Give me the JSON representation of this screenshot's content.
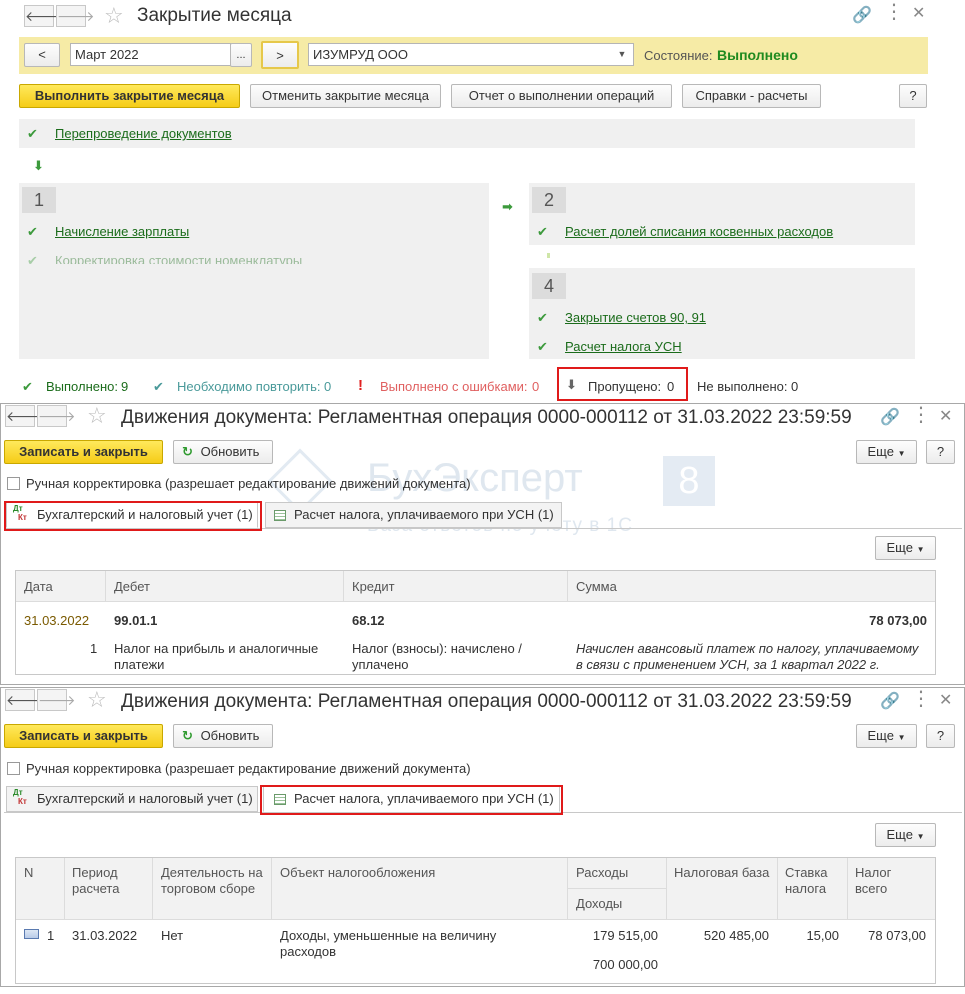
{
  "window1": {
    "title": "Закрытие месяца",
    "period": "Март 2022",
    "period_dots": "...",
    "prev": "<",
    "next": ">",
    "org": "ИЗУМРУД ООО",
    "state_label": "Состояние:",
    "state_value": "Выполнено",
    "buttons": {
      "run": "Выполнить закрытие месяца",
      "cancel": "Отменить закрытие месяца",
      "report": "Отчет о выполнении операций",
      "refs": "Справки - расчеты",
      "help": "?"
    },
    "reposting": "Перепроведение документов",
    "step1": {
      "num": "1",
      "item1": "Начисление зарплаты",
      "item2": "Корректировка стоимости номенклатуры"
    },
    "step2": {
      "num": "2",
      "item1": "Расчет долей списания косвенных расходов"
    },
    "step4": {
      "num": "4",
      "item1": "Закрытие счетов 90, 91",
      "item2": "Расчет налога УСН"
    },
    "status": {
      "done_label": "Выполнено:",
      "done_count": "9",
      "repeat_label": "Необходимо повторить:",
      "repeat_count": "0",
      "errors_label": "Выполнено с ошибками:",
      "errors_count": "0",
      "skipped_label": "Пропущено:",
      "skipped_count": "0",
      "notdone_label": "Не выполнено:",
      "notdone_count": "0"
    }
  },
  "movement_window": {
    "title": "Движения документа: Регламентная операция 0000-000112 от 31.03.2022 23:59:59",
    "save_close": "Записать и закрыть",
    "refresh": "Обновить",
    "more": "Еще",
    "help": "?",
    "manual_correction": "Ручная корректировка (разрешает редактирование движений документа)",
    "tab_accounting": "Бухгалтерский и налоговый учет (1)",
    "tab_usn": "Расчет налога, уплачиваемого при УСН (1)",
    "tab_icon_dt": "Дт",
    "tab_icon_kt": "Кт"
  },
  "watermark": {
    "brand": "БухЭксперт",
    "digit": "8",
    "tagline": "База ответов по учёту в 1С"
  },
  "accounting_table": {
    "headers": [
      "Дата",
      "Дебет",
      "Кредит",
      "Сумма"
    ],
    "row": {
      "date": "31.03.2022",
      "debit": "99.01.1",
      "credit": "68.12",
      "amount": "78 073,00",
      "num": "1",
      "debit_sub": "Налог на прибыль и аналогичные платежи",
      "credit_sub": "Налог (взносы): начислено / уплачено",
      "content": "Начислен авансовый платеж по налогу, уплачиваемому в связи с применением УСН, за 1 квартал 2022 г."
    }
  },
  "usn_table": {
    "headers": {
      "n": "N",
      "period": "Период расчета",
      "activity": "Деятельность на торговом сборе",
      "object": "Объект налогообложения",
      "expenses": "Расходы",
      "income": "Доходы",
      "base": "Налоговая база",
      "rate": "Ставка налога",
      "tax": "Налог всего"
    },
    "row": {
      "n": "1",
      "period": "31.03.2022",
      "activity": "Нет",
      "object": "Доходы, уменьшенные на величину расходов",
      "expenses": "179 515,00",
      "income": "700 000,00",
      "base": "520 485,00",
      "rate": "15,00",
      "tax": "78 073,00"
    }
  },
  "colors": {
    "accent_green": "#1b6c1b",
    "yellow_bar": "#f6eba6",
    "highlight_red": "#e01a1a",
    "error_red": "#e06060",
    "repeat_teal": "#4a9a9a"
  }
}
